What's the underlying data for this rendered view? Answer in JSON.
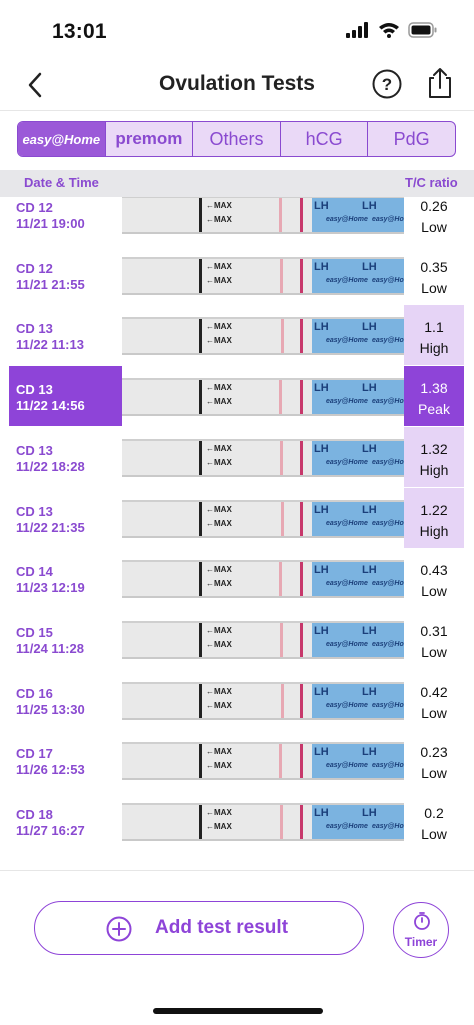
{
  "status": {
    "time": "13:01"
  },
  "nav": {
    "title": "Ovulation Tests",
    "back_icon": "chevron-left-icon",
    "help_icon": "question-circle-icon",
    "share_icon": "share-icon"
  },
  "tabs": [
    {
      "label": "easy@Home",
      "active": true
    },
    {
      "label": "premom",
      "active": false
    },
    {
      "label": "Others",
      "active": false
    },
    {
      "label": "hCG",
      "active": false
    },
    {
      "label": "PdG",
      "active": false
    }
  ],
  "columns": {
    "left": "Date & Time",
    "right": "T/C ratio"
  },
  "strip_text": {
    "max": "←MAX",
    "lh": "LH",
    "brand": "easy@Home"
  },
  "tests": [
    {
      "cd": "CD 12",
      "datetime": "11/21 19:00",
      "ratio": "0.26",
      "status": "Low",
      "level": "low",
      "selected": false
    },
    {
      "cd": "CD 12",
      "datetime": "11/21 21:55",
      "ratio": "0.35",
      "status": "Low",
      "level": "low",
      "selected": false
    },
    {
      "cd": "CD 13",
      "datetime": "11/22 11:13",
      "ratio": "1.1",
      "status": "High",
      "level": "high",
      "selected": false
    },
    {
      "cd": "CD 13",
      "datetime": "11/22 14:56",
      "ratio": "1.38",
      "status": "Peak",
      "level": "peak",
      "selected": true
    },
    {
      "cd": "CD 13",
      "datetime": "11/22 18:28",
      "ratio": "1.32",
      "status": "High",
      "level": "high",
      "selected": false
    },
    {
      "cd": "CD 13",
      "datetime": "11/22 21:35",
      "ratio": "1.22",
      "status": "High",
      "level": "high",
      "selected": false
    },
    {
      "cd": "CD 14",
      "datetime": "11/23 12:19",
      "ratio": "0.43",
      "status": "Low",
      "level": "low",
      "selected": false
    },
    {
      "cd": "CD 15",
      "datetime": "11/24 11:28",
      "ratio": "0.31",
      "status": "Low",
      "level": "low",
      "selected": false
    },
    {
      "cd": "CD 16",
      "datetime": "11/25 13:30",
      "ratio": "0.42",
      "status": "Low",
      "level": "low",
      "selected": false
    },
    {
      "cd": "CD 17",
      "datetime": "11/26 12:53",
      "ratio": "0.23",
      "status": "Low",
      "level": "low",
      "selected": false
    },
    {
      "cd": "CD 18",
      "datetime": "11/27 16:27",
      "ratio": "0.2",
      "status": "Low",
      "level": "low",
      "selected": false
    }
  ],
  "actions": {
    "add_label": "Add test result",
    "timer_label": "Timer",
    "add_icon": "plus-circle-icon",
    "timer_icon": "stopwatch-icon"
  },
  "colors": {
    "accent": "#8e44d8",
    "high_bg": "#e6d4f6",
    "control_line": "#c7386b",
    "test_line": "#e7a8b3"
  }
}
